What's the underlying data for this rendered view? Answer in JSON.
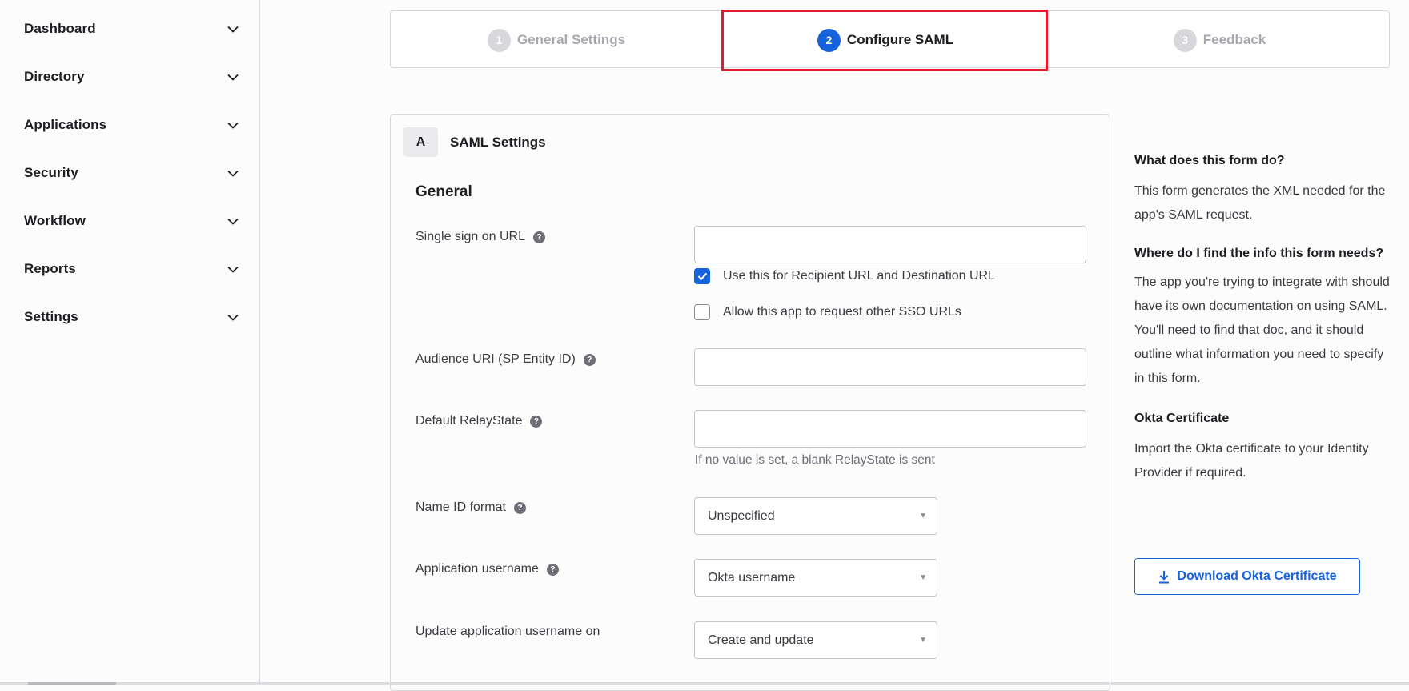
{
  "sidebar": {
    "items": [
      {
        "label": "Dashboard",
        "icon": "chevron-down-icon"
      },
      {
        "label": "Directory",
        "icon": "chevron-down-icon"
      },
      {
        "label": "Applications",
        "icon": "chevron-down-icon"
      },
      {
        "label": "Security",
        "icon": "chevron-down-icon"
      },
      {
        "label": "Workflow",
        "icon": "chevron-down-icon"
      },
      {
        "label": "Reports",
        "icon": "chevron-down-icon"
      },
      {
        "label": "Settings",
        "icon": "chevron-down-icon"
      }
    ]
  },
  "stepper": {
    "steps": [
      {
        "number": "1",
        "label": "General Settings",
        "state": "inactive"
      },
      {
        "number": "2",
        "label": "Configure SAML",
        "state": "active"
      },
      {
        "number": "3",
        "label": "Feedback",
        "state": "inactive"
      }
    ]
  },
  "colors": {
    "accent": "#1662dd",
    "highlight": "#e21a2b",
    "inactive_step": "#d7d7dc",
    "help_icon": "#6e6e78"
  },
  "form": {
    "section_badge": "A",
    "section_title": "SAML Settings",
    "group_title": "General",
    "fields": {
      "sso_url": {
        "label": "Single sign on URL",
        "value": "",
        "help_icon": "question-circle-icon"
      },
      "use_for_recipient": {
        "label": "Use this for Recipient URL and Destination URL",
        "checked": true
      },
      "allow_other_sso": {
        "label": "Allow this app to request other SSO URLs",
        "checked": false
      },
      "audience_uri": {
        "label": "Audience URI (SP Entity ID)",
        "value": "",
        "help_icon": "question-circle-icon"
      },
      "relay_state": {
        "label": "Default RelayState",
        "value": "",
        "hint": "If no value is set, a blank RelayState is sent",
        "help_icon": "question-circle-icon"
      },
      "name_id_format": {
        "label": "Name ID format",
        "value": "Unspecified",
        "help_icon": "question-circle-icon"
      },
      "app_username": {
        "label": "Application username",
        "value": "Okta username",
        "help_icon": "question-circle-icon"
      },
      "update_username_on": {
        "label": "Update application username on",
        "value": "Create and update"
      }
    }
  },
  "help_panel": {
    "q1": "What does this form do?",
    "a1": "This form generates the XML needed for the app's SAML request.",
    "q2": "Where do I find the info this form needs?",
    "a2": "The app you're trying to integrate with should have its own documentation on using SAML. You'll need to find that doc, and it should outline what information you need to specify in this form.",
    "q3": "Okta Certificate",
    "a3": "Import the Okta certificate to your Identity Provider if required.",
    "download_button": "Download Okta Certificate"
  },
  "help_glyph": "?",
  "caret_glyph": "▼"
}
